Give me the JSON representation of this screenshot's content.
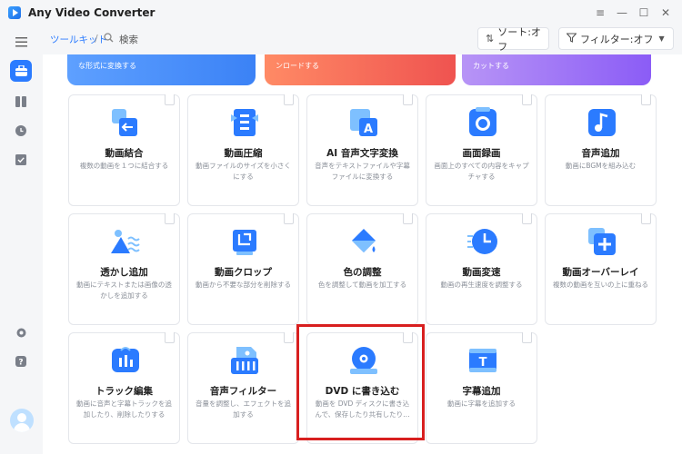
{
  "app": {
    "title": "Any Video Converter"
  },
  "window_controls": {
    "menu": "≡",
    "minimize": "—",
    "maximize": "☐",
    "close": "✕"
  },
  "header": {
    "breadcrumb": "ツールキット",
    "separator": "/",
    "search_label": "検索",
    "sort_label": "ソート:オフ",
    "filter_label": "フィルター:オフ"
  },
  "banners": [
    {
      "text": "な形式に変換する",
      "color": "#4a90ff"
    },
    {
      "text": "ンロードする",
      "color": "#ef5350"
    },
    {
      "text": "カットする",
      "color": "#9c6cf0"
    }
  ],
  "cards": [
    {
      "title": "動画結合",
      "desc": "複数の動画を１つに結合する",
      "icon": "merge-icon"
    },
    {
      "title": "動画圧縮",
      "desc": "動画ファイルのサイズを小さくにする",
      "icon": "compress-icon"
    },
    {
      "title": "AI 音声文字変換",
      "desc": "音声をテキストファイルや字幕ファイルに変換する",
      "icon": "ai-transcribe-icon"
    },
    {
      "title": "画面録画",
      "desc": "画面上のすべての内容をキャプチャする",
      "icon": "screen-record-icon"
    },
    {
      "title": "音声追加",
      "desc": "動画にBGMを組み込む",
      "icon": "add-audio-icon"
    },
    {
      "title": "透かし追加",
      "desc": "動画にテキストまたは画像の透かしを追加する",
      "icon": "watermark-icon"
    },
    {
      "title": "動画クロップ",
      "desc": "動画から不要な部分を削除する",
      "icon": "crop-icon"
    },
    {
      "title": "色の調整",
      "desc": "色を調整して動画を加工する",
      "icon": "color-adjust-icon"
    },
    {
      "title": "動画変速",
      "desc": "動画の再生速度を調整する",
      "icon": "speed-icon"
    },
    {
      "title": "動画オーバーレイ",
      "desc": "複数の動画を互いの上に重ねる",
      "icon": "overlay-icon"
    },
    {
      "title": "トラック編集",
      "desc": "動画に音声と字幕トラックを追加したり、削除したりする",
      "icon": "track-edit-icon"
    },
    {
      "title": "音声フィルター",
      "desc": "音量を調整し、エフェクトを追加する",
      "icon": "audio-filter-icon"
    },
    {
      "title": "DVD に書き込む",
      "desc": "動画を DVD ディスクに書き込んで、保存したり共有したり…",
      "icon": "dvd-burn-icon"
    },
    {
      "title": "字幕追加",
      "desc": "動画に字幕を追加する",
      "icon": "subtitle-icon"
    }
  ],
  "sidebar": [
    "toolkit-icon",
    "library-icon",
    "history-icon",
    "tasks-icon",
    "settings-icon",
    "help-icon"
  ],
  "accent": "#2b7bff",
  "highlight_color": "#d81f1f"
}
